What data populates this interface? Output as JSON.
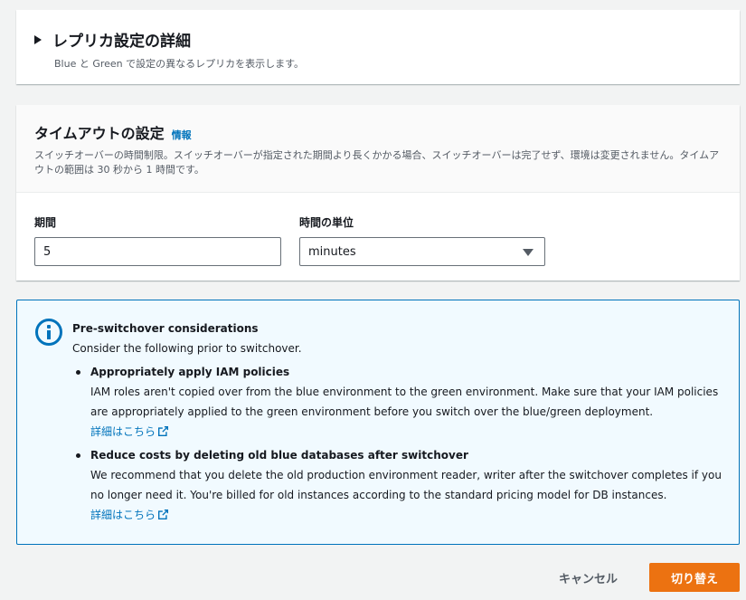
{
  "replica": {
    "title": "レプリカ設定の詳細",
    "description": "Blue と Green で設定の異なるレプリカを表示します。"
  },
  "timeout": {
    "title": "タイムアウトの設定",
    "info_link": "情報",
    "description": "スイッチオーバーの時間制限。スイッチオーバーが指定された期間より長くかかる場合、スイッチオーバーは完了せず、環境は変更されません。タイムアウトの範囲は 30 秒から 1 時間です。",
    "duration_label": "期間",
    "duration_value": "5",
    "unit_label": "時間の単位",
    "unit_value": "minutes"
  },
  "alert": {
    "title": "Pre-switchover considerations",
    "intro": "Consider the following prior to switchover.",
    "items": [
      {
        "title": "Appropriately apply IAM policies",
        "text": "IAM roles aren't copied over from the blue environment to the green environment. Make sure that your IAM policies are appropriately applied to the green environment before you switch over the blue/green deployment.",
        "link": "詳細はこちら"
      },
      {
        "title": "Reduce costs by deleting old blue databases after switchover",
        "text": "We recommend that you delete the old production environment reader, writer after the switchover completes if you no longer need it. You're billed for old instances according to the standard pricing model for DB instances.",
        "link": "詳細はこちら"
      }
    ]
  },
  "footer": {
    "cancel_label": "キャンセル",
    "submit_label": "切り替え"
  },
  "colors": {
    "primary": "#ec7211",
    "link": "#0073bb",
    "alert_bg": "#f1faff"
  }
}
